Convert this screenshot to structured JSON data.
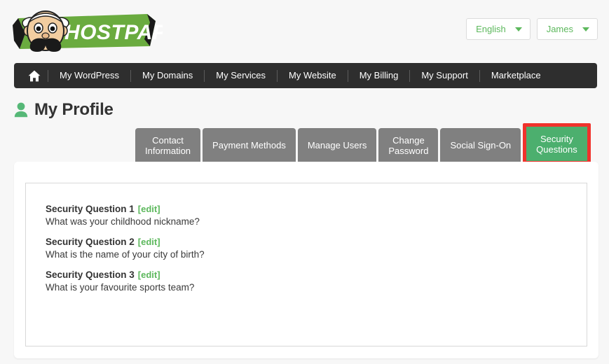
{
  "brand": {
    "logo_text": "HOSTPAPA",
    "logo_alt": "hostpapa-logo",
    "green": "#6aab3f",
    "accent_green": "#5cb85c",
    "active_tab_green": "#4caf6e",
    "highlight_red": "#f0322c",
    "nav_dark": "#2e2e2e",
    "tab_gray": "#808080"
  },
  "header": {
    "language_dropdown": "English",
    "account_dropdown": "James"
  },
  "nav": {
    "home_icon": "home-icon",
    "items": [
      {
        "label": "My WordPress"
      },
      {
        "label": "My Domains"
      },
      {
        "label": "My Services"
      },
      {
        "label": "My Website"
      },
      {
        "label": "My Billing"
      },
      {
        "label": "My Support"
      },
      {
        "label": "Marketplace"
      }
    ]
  },
  "page": {
    "title": "My Profile",
    "title_icon": "user-icon"
  },
  "tabs": [
    {
      "label": "Contact\nInformation",
      "active": false
    },
    {
      "label": "Payment Methods",
      "active": false
    },
    {
      "label": "Manage Users",
      "active": false
    },
    {
      "label": "Change\nPassword",
      "active": false
    },
    {
      "label": "Social Sign-On",
      "active": false
    },
    {
      "label": "Security\nQuestions",
      "active": true
    }
  ],
  "security_questions": {
    "edit_label": "[edit]",
    "items": [
      {
        "heading": "Security Question 1",
        "question": "What was your childhood nickname?"
      },
      {
        "heading": "Security Question 2",
        "question": "What is the name of your city of birth?"
      },
      {
        "heading": "Security Question 3",
        "question": "What is your favourite sports team?"
      }
    ]
  }
}
